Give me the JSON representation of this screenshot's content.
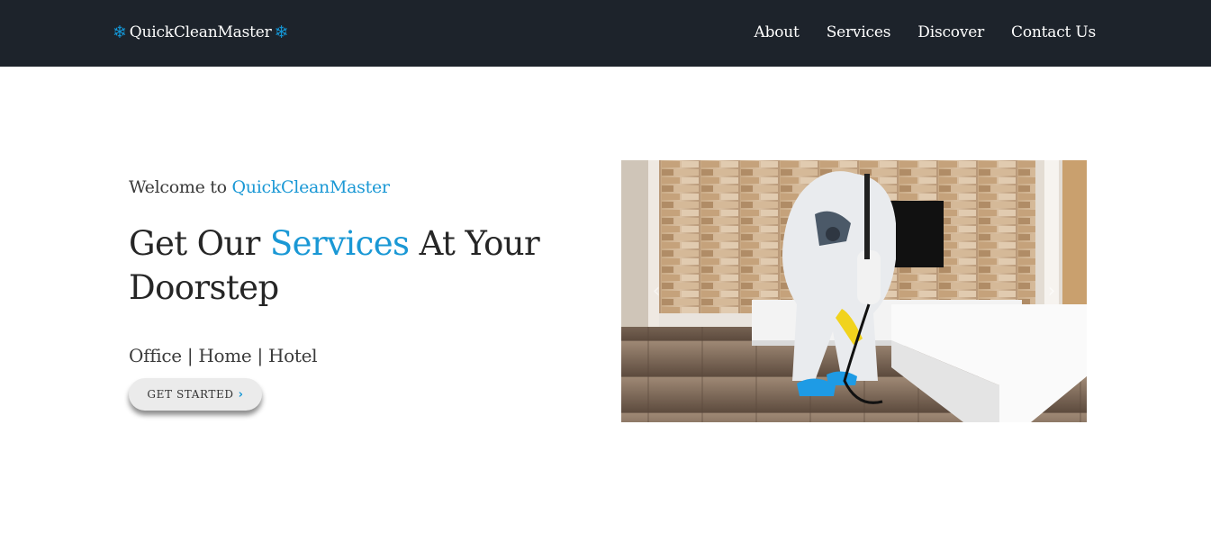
{
  "nav": {
    "brand_text": "QuickCleanMaster",
    "brand_icon": "snowflake-icon",
    "links": [
      "About",
      "Services",
      "Discover",
      "Contact Us"
    ]
  },
  "hero": {
    "welcome_prefix": "Welcome to",
    "welcome_brand": "QuickCleanMaster",
    "headline_part1": "Get Our",
    "headline_accent": "Services",
    "headline_part2": "At Your Doorstep",
    "tagline": "Office | Home | Hotel",
    "cta_label": "GET STARTED"
  },
  "carousel": {
    "image": "person-in-protective-suit-disinfecting-living-room",
    "prev_icon": "chevron-left-icon",
    "next_icon": "chevron-right-icon"
  },
  "colors": {
    "navbar": "#1d232b",
    "accent": "#1a98d5",
    "button_bg": "#ebebeb"
  }
}
